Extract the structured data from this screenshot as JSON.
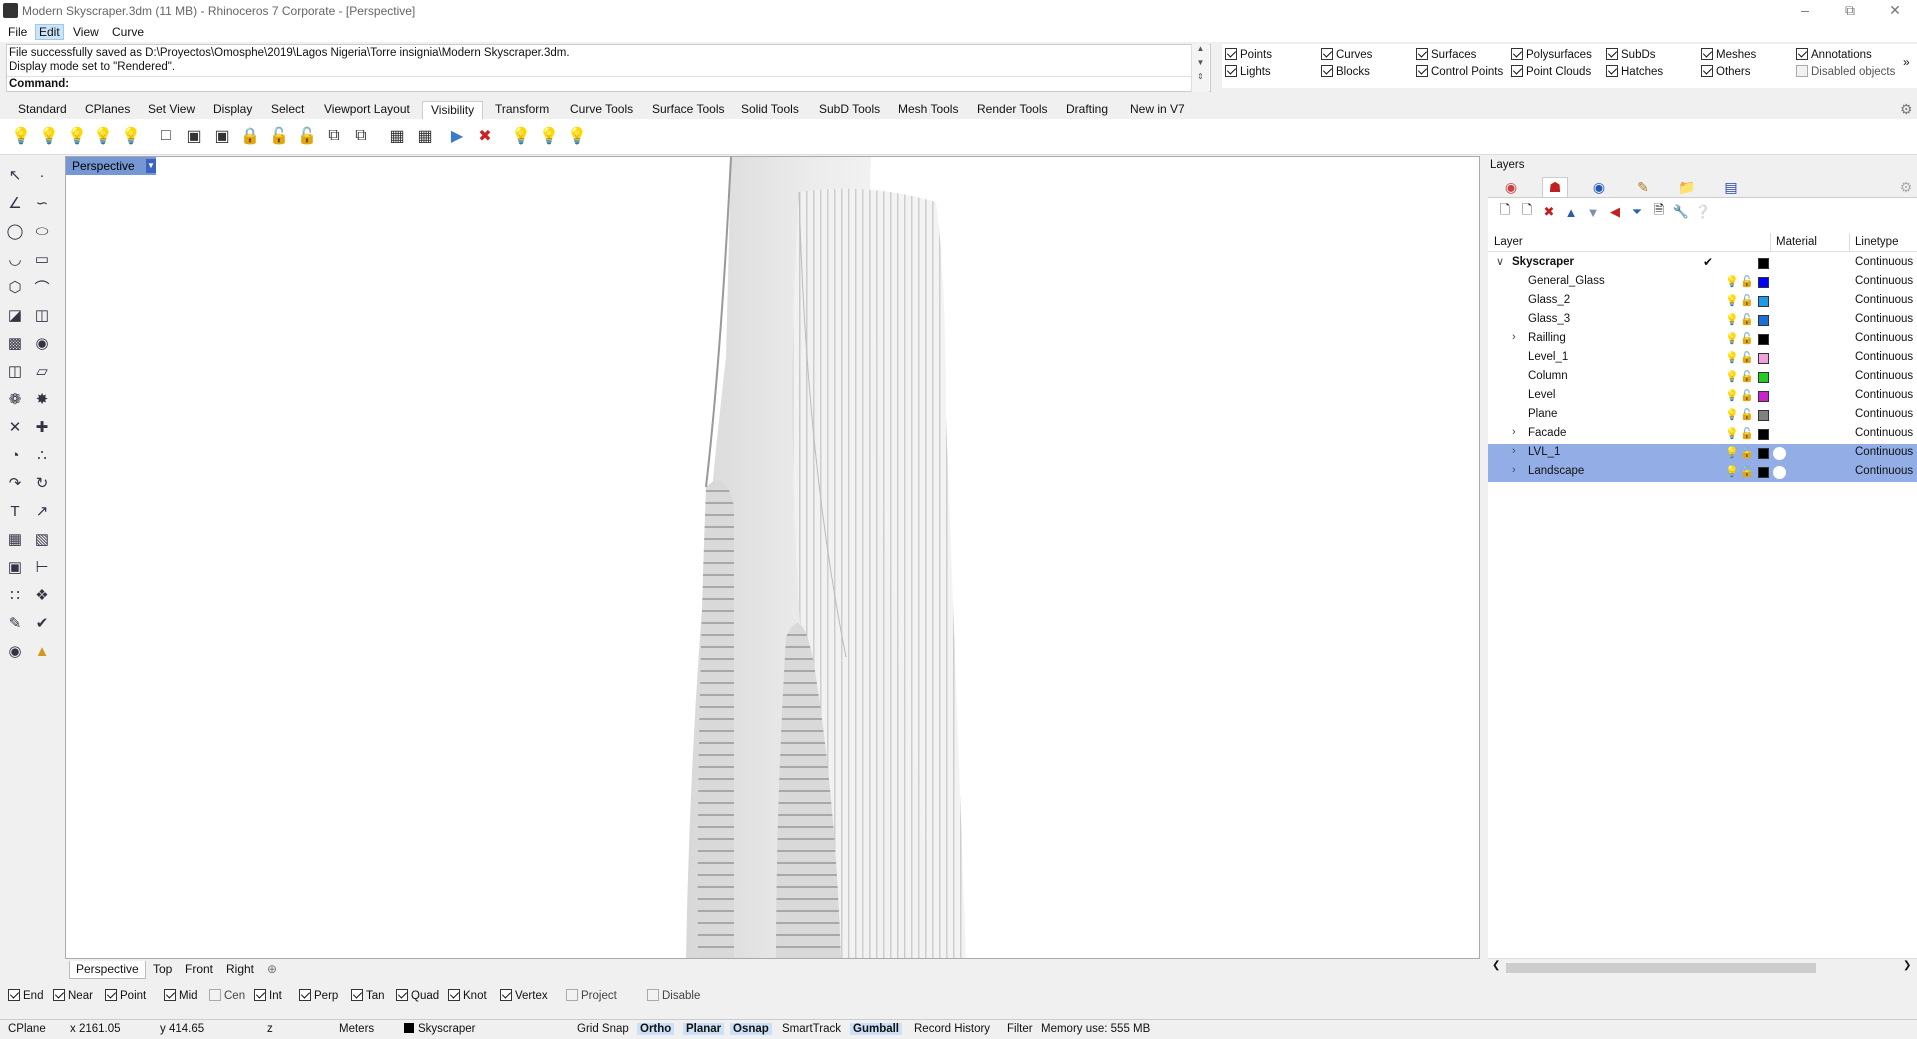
{
  "window": {
    "title": "Modern Skyscraper.3dm (11 MB) - Rhinoceros 7 Corporate - [Perspective]"
  },
  "menu": {
    "items": [
      "File",
      "Edit",
      "View",
      "Curve"
    ]
  },
  "command": {
    "history_1": "File successfully saved as D:\\Proyectos\\Omosphe\\2019\\Lagos Nigeria\\Torre insignia\\Modern Skyscraper.3dm.",
    "history_2": "Display mode set to \"Rendered\".",
    "prompt_label": "Command:",
    "input_value": ""
  },
  "visibility": {
    "row1": [
      {
        "label": "Points",
        "checked": true
      },
      {
        "label": "Curves",
        "checked": true
      },
      {
        "label": "Surfaces",
        "checked": true
      },
      {
        "label": "Polysurfaces",
        "checked": true
      },
      {
        "label": "SubDs",
        "checked": true
      },
      {
        "label": "Meshes",
        "checked": true
      },
      {
        "label": "Annotations",
        "checked": true
      }
    ],
    "row2": [
      {
        "label": "Lights",
        "checked": true
      },
      {
        "label": "Blocks",
        "checked": true
      },
      {
        "label": "Control Points",
        "checked": true
      },
      {
        "label": "Point Clouds",
        "checked": true
      },
      {
        "label": "Hatches",
        "checked": true
      },
      {
        "label": "Others",
        "checked": true
      },
      {
        "label": "Disabled objects",
        "checked": false
      }
    ]
  },
  "toolbar_tabs": [
    "Standard",
    "CPlanes",
    "Set View",
    "Display",
    "Select",
    "Viewport Layout",
    "Visibility",
    "Transform",
    "Curve Tools",
    "Surface Tools",
    "Solid Tools",
    "SubD Tools",
    "Mesh Tools",
    "Render Tools",
    "Drafting",
    "New in V7"
  ],
  "active_toolbar_tab": "Visibility",
  "viewport": {
    "name": "Perspective",
    "tabs": [
      "Perspective",
      "Top",
      "Front",
      "Right"
    ]
  },
  "layers": {
    "panel_title": "Layers",
    "columns": {
      "layer": "Layer",
      "material": "Material",
      "linetype": "Linetype"
    },
    "rows": [
      {
        "name": "Skyscraper",
        "color": "#000000",
        "linetype": "Continuous",
        "current": true,
        "expander": "open",
        "selected": false
      },
      {
        "name": "General_Glass",
        "color": "#0000ff",
        "linetype": "Continuous",
        "selected": false
      },
      {
        "name": "Glass_2",
        "color": "#1e9be6",
        "linetype": "Continuous",
        "selected": false
      },
      {
        "name": "Glass_3",
        "color": "#1a6fd6",
        "linetype": "Continuous",
        "selected": false
      },
      {
        "name": "Railling",
        "color": "#000000",
        "linetype": "Continuous",
        "expander": "closed",
        "selected": false
      },
      {
        "name": "Level_1",
        "color": "#f0a0d8",
        "linetype": "Continuous",
        "selected": false
      },
      {
        "name": "Column",
        "color": "#22cc22",
        "linetype": "Continuous",
        "selected": false
      },
      {
        "name": "Level",
        "color": "#cc22cc",
        "linetype": "Continuous",
        "selected": false
      },
      {
        "name": "Plane",
        "color": "#808080",
        "linetype": "Continuous",
        "selected": false
      },
      {
        "name": "Facade",
        "color": "#000000",
        "linetype": "Continuous",
        "expander": "closed",
        "selected": false
      },
      {
        "name": "LVL_1",
        "color": "#000000",
        "linetype": "Continuous",
        "expander": "closed",
        "selected": true
      },
      {
        "name": "Landscape",
        "color": "#000000",
        "linetype": "Continuous",
        "expander": "closed",
        "selected": true
      }
    ]
  },
  "osnaps": [
    {
      "label": "End",
      "checked": true
    },
    {
      "label": "Near",
      "checked": true
    },
    {
      "label": "Point",
      "checked": true
    },
    {
      "label": "Mid",
      "checked": true
    },
    {
      "label": "Cen",
      "checked": false
    },
    {
      "label": "Int",
      "checked": true
    },
    {
      "label": "Perp",
      "checked": true
    },
    {
      "label": "Tan",
      "checked": true
    },
    {
      "label": "Quad",
      "checked": true
    },
    {
      "label": "Knot",
      "checked": true
    },
    {
      "label": "Vertex",
      "checked": true
    },
    {
      "label": "Project",
      "checked": false
    },
    {
      "label": "Disable",
      "checked": false
    }
  ],
  "status": {
    "cplane": "CPlane",
    "x": "x 2161.05",
    "y": "y 414.65",
    "z": "z",
    "units": "Meters",
    "layer": "Skyscraper",
    "grid_snap": "Grid Snap",
    "ortho": "Ortho",
    "planar": "Planar",
    "osnap": "Osnap",
    "smarttrack": "SmartTrack",
    "gumball": "Gumball",
    "record_history": "Record History",
    "filter": "Filter",
    "memory": "Memory use: 555 MB"
  }
}
